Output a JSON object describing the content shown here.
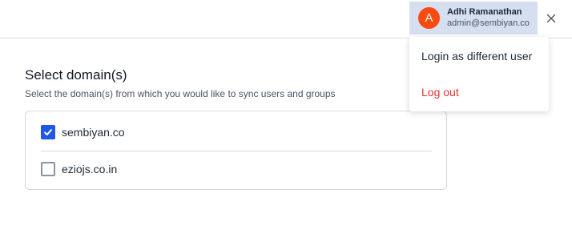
{
  "header": {
    "user": {
      "avatar_initial": "A",
      "name": "Adhi Ramanathan",
      "email": "admin@sembiyan.co",
      "avatar_color": "#fa4a0f"
    },
    "close_icon": "close-icon"
  },
  "user_menu": {
    "items": [
      {
        "label": "Login as different user",
        "type": "default"
      },
      {
        "label": "Log out",
        "type": "danger"
      }
    ],
    "danger_color": "#e5332d"
  },
  "main": {
    "title": "Select domain(s)",
    "subtitle": "Select the domain(s) from which you would like to sync users and groups",
    "domains": [
      {
        "label": "sembiyan.co",
        "checked": true
      },
      {
        "label": "eziojs.co.in",
        "checked": false
      }
    ],
    "checkbox_color": "#1f57e6"
  }
}
